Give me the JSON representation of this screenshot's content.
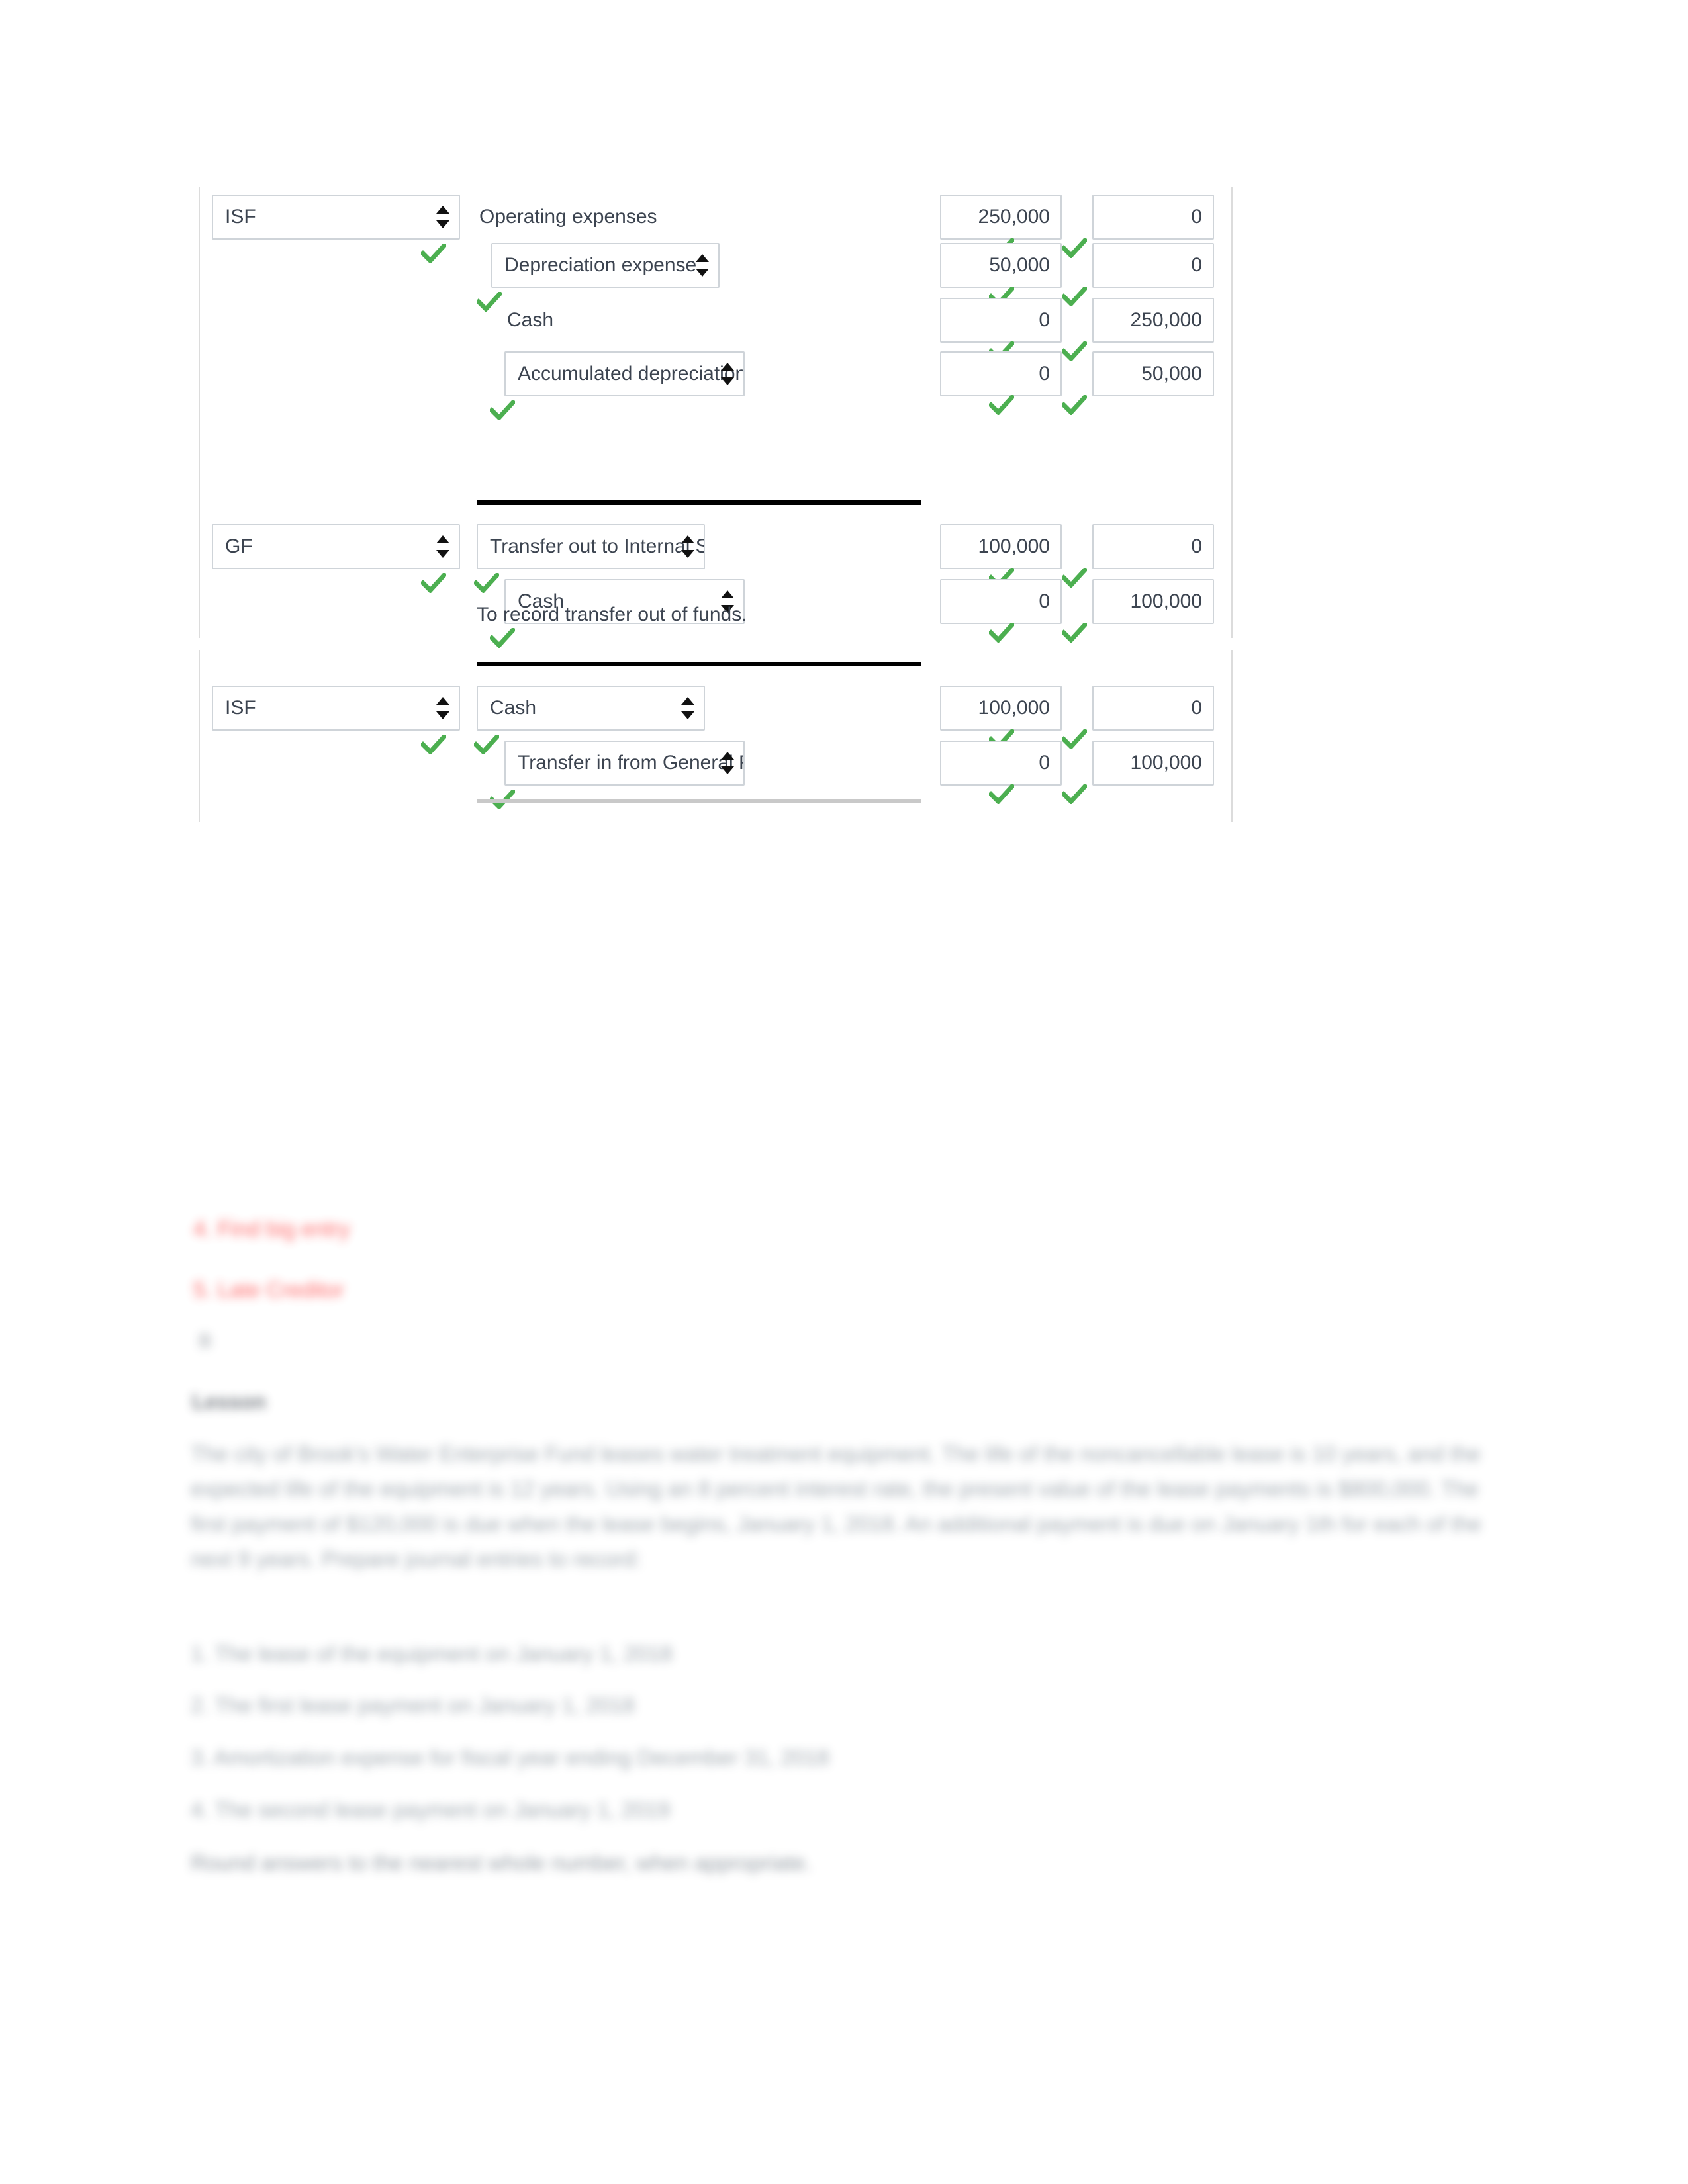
{
  "form": {
    "blocks": [
      {
        "id": "block-isf-depreciation",
        "has_top_rule": false,
        "rows": [
          {
            "fund": {
              "type": "select",
              "value": "ISF",
              "checked": true
            },
            "account": {
              "type": "text",
              "indent": 0,
              "value": "Operating expenses",
              "checked": false
            },
            "debit": {
              "value": "250,000",
              "checked": true
            },
            "credit": {
              "value": "0",
              "checked": true
            }
          },
          {
            "fund": {
              "type": "none",
              "value": "",
              "checked": false
            },
            "account": {
              "type": "select",
              "indent": 1,
              "value": "Depreciation expense",
              "checked": true
            },
            "debit": {
              "value": "50,000",
              "checked": true
            },
            "credit": {
              "value": "0",
              "checked": true
            }
          },
          {
            "fund": {
              "type": "none",
              "value": "",
              "checked": false
            },
            "account": {
              "type": "text",
              "indent": 2,
              "value": "Cash",
              "checked": false
            },
            "debit": {
              "value": "0",
              "checked": true
            },
            "credit": {
              "value": "250,000",
              "checked": true
            }
          },
          {
            "fund": {
              "type": "none",
              "value": "",
              "checked": false
            },
            "account": {
              "type": "select",
              "indent": 2,
              "value": "Accumulated depreciation",
              "checked": true
            },
            "debit": {
              "value": "0",
              "checked": true
            },
            "credit": {
              "value": "50,000",
              "checked": true
            }
          }
        ],
        "memo": ""
      },
      {
        "id": "block-gf-transfer-out",
        "has_top_rule": true,
        "rows": [
          {
            "fund": {
              "type": "select",
              "value": "GF",
              "checked": true
            },
            "account": {
              "type": "select",
              "indent": 1,
              "value": "Transfer out to Internal Service Fund",
              "checked": true
            },
            "debit": {
              "value": "100,000",
              "checked": true
            },
            "credit": {
              "value": "0",
              "checked": true
            }
          },
          {
            "fund": {
              "type": "none",
              "value": "",
              "checked": false
            },
            "account": {
              "type": "select",
              "indent": 2,
              "value": "Cash",
              "checked": true
            },
            "debit": {
              "value": "0",
              "checked": true
            },
            "credit": {
              "value": "100,000",
              "checked": true
            }
          }
        ],
        "memo": "To record transfer out of funds."
      },
      {
        "id": "block-isf-transfer-in",
        "has_top_rule": true,
        "rows": [
          {
            "fund": {
              "type": "select",
              "value": "ISF",
              "checked": true
            },
            "account": {
              "type": "select",
              "indent": 1,
              "value": "Cash",
              "checked": true
            },
            "debit": {
              "value": "100,000",
              "checked": true
            },
            "credit": {
              "value": "0",
              "checked": true
            }
          },
          {
            "fund": {
              "type": "none",
              "value": "",
              "checked": false
            },
            "account": {
              "type": "select",
              "indent": 2,
              "value": "Transfer in from General Fund",
              "checked": true
            },
            "debit": {
              "value": "0",
              "checked": true
            },
            "credit": {
              "value": "100,000",
              "checked": true
            }
          }
        ],
        "memo": ""
      }
    ]
  },
  "obscured": {
    "red_links": [
      "4.  Find big entry",
      "5.  Late Creditor"
    ],
    "marker": "B",
    "section_label": "Lesson",
    "paragraph": "The city of Brook's Water Enterprise Fund leases water treatment equipment. The life of the noncancellable lease is 10 years, and the expected life of the equipment is 12 years. Using an 8 percent interest rate, the present value of the lease payments is $800,000. The first payment of $120,000 is due when the lease begins, January 1, 2018. An additional payment is due on January 1th for each of the next 9 years. Prepare journal entries to record:",
    "list": [
      "1. The lease of the equipment on January 1, 2018",
      "2. The first lease payment on January 1, 2018",
      "3. Amortization expense for fiscal year ending December 31, 2018",
      "4. The second lease payment on January 1, 2019"
    ],
    "closing": "Round answers to the nearest whole number, when appropriate."
  },
  "colors": {
    "check_green": "#4caf50",
    "field_border": "#cfd4d9",
    "container_border": "#dcdcdc",
    "rule_black": "#000000",
    "red_link": "#ff5a5a",
    "text": "#3c4450"
  }
}
